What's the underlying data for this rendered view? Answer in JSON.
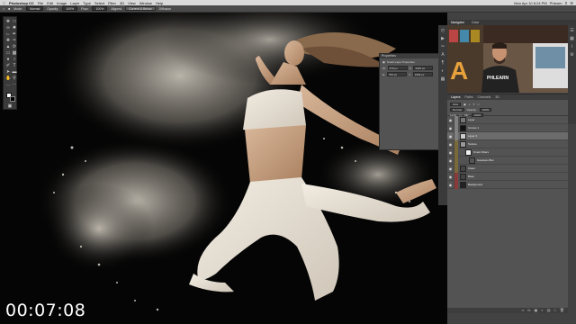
{
  "menubar": {
    "app_name": "Photoshop CC",
    "items": [
      "File",
      "Edit",
      "Image",
      "Layer",
      "Type",
      "Select",
      "Filter",
      "3D",
      "View",
      "Window",
      "Help"
    ],
    "clock": "Mon Apr 10 8:24 PM",
    "user": "Phlearn"
  },
  "options_bar": {
    "mode_label": "Mode:",
    "mode_value": "Normal",
    "opacity_label": "Opacity:",
    "opacity_value": "100%",
    "flow_label": "Flow:",
    "flow_value": "100%",
    "aligned_label": "Aligned",
    "sample_value": "Current & Below",
    "diffusion_label": "Diffusion"
  },
  "properties_panel": {
    "title": "Properties",
    "section": "Smart Layer Properties",
    "w_label": "W:",
    "w_value": "679 px",
    "h_label": "H:",
    "h_value": "763 px",
    "x_label": "X:",
    "x_value": "2316 px",
    "y_label": "Y:",
    "y_value": "1939 px"
  },
  "navigator": {
    "tabs": [
      "Navigator",
      "Color"
    ]
  },
  "layers_panel": {
    "tabs": [
      "Layers",
      "Paths",
      "Channels",
      "3D"
    ],
    "kind_label": "Kind",
    "blend_mode": "Normal",
    "opacity_label": "Opacity:",
    "opacity_value": "100%",
    "lock_label": "Lock:",
    "fill_label": "Fill:",
    "fill_value": "100%",
    "layers": [
      {
        "name": "Layer",
        "color": "#808080",
        "thumb": "#777"
      },
      {
        "name": "Curves 1",
        "color": "#808080",
        "thumb": "#111"
      },
      {
        "name": "Layer 4",
        "color": "#808080",
        "thumb": "#ccc"
      },
      {
        "name": "Texture",
        "color": "#7a6a3a",
        "thumb": "#999"
      },
      {
        "name": "Smart Filters",
        "color": "#7a6a3a",
        "thumb": "#eee"
      },
      {
        "name": "Gaussian Blur",
        "color": "#7a6a3a",
        "thumb": "#555"
      },
      {
        "name": "Clean",
        "color": "#7a6a3a",
        "thumb": "#444"
      },
      {
        "name": "Base",
        "color": "#8a3a3a",
        "thumb": "#444"
      },
      {
        "name": "Background",
        "color": "#8a3a3a",
        "thumb": "#222"
      }
    ]
  },
  "webcam": {
    "shirt_text": "PHLEARN",
    "sign_letter": "A"
  },
  "colors": {
    "panel_bg": "#535353",
    "panel_dark": "#3d3d3d",
    "menubar": "#d9d9d9",
    "layer_selected": "#6b6b6b"
  },
  "timer": "00:07:08"
}
